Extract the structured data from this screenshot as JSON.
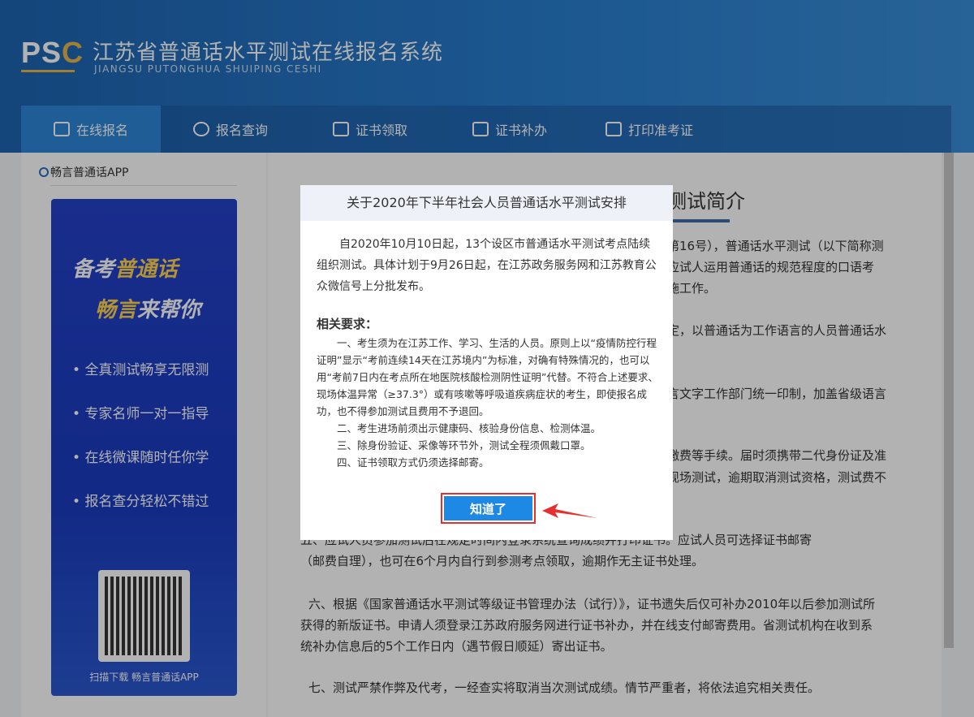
{
  "header": {
    "logo": "PSC",
    "title": "江苏省普通话水平测试在线报名系统",
    "subtitle": "JIANGSU PUTONGHUA SHUIPING CESHI"
  },
  "nav": [
    {
      "label": "在线报名",
      "icon": "edit-icon"
    },
    {
      "label": "报名查询",
      "icon": "search-icon"
    },
    {
      "label": "证书领取",
      "icon": "certificate-icon"
    },
    {
      "label": "证书补办",
      "icon": "certificate-icon"
    },
    {
      "label": "打印准考证",
      "icon": "printer-icon"
    }
  ],
  "sidebar": {
    "title": "畅言普通话APP",
    "banner_line1_a": "备考",
    "banner_line1_b": "普通话",
    "banner_line2_a": "畅言",
    "banner_line2_b": "来帮你",
    "features": [
      "全真测试畅享无限测",
      "专家名师一对一指导",
      "在线微课随时任你学",
      "报名查分轻松不错过"
    ],
    "qr_caption": "扫描下载 畅言普通话APP"
  },
  "article": {
    "title": "测试简介",
    "lines": [
      "第16号），普通话水平测试（以下简称测",
      "应试人运用普通话的规范程度的口语考",
      "施工作。",
      "定，以普通话为工作语言的人员普通话水",
      "言文字工作部门统一印制，加盖省级语言",
      "缴费等手续。届时须携带二代身份证及准",
      "现场测试，逾期取消测试资格，测试费不",
      "五、应试人员参加测试后在规定时间内登录系统查询成绩并打印证书。应试人员可选择证书邮寄",
      "（邮费自理），也可在6个月内自行到参测考点领取，逾期作无主证书处理。",
      "六、根据《国家普通话水平测试等级证书管理办法（试行）》，证书遗失后仅可补办2010年以后参加测试所",
      "获得的新版证书。申请人须登录江苏政府服务网进行证书补办，并在线支付邮寄费用。省测试机构在收到系",
      "统补办信息后的5个工作日内（遇节假日顺延）寄出证书。",
      "七、测试严禁作弊及代考，一经查实将取消当次测试成绩。情节严重者，将依法追究相关责任。"
    ]
  },
  "modal": {
    "title": "关于2020年下半年社会人员普通话水平测试安排",
    "intro": "自2020年10月10日起，13个设区市普通话水平测试考点陆续组织测试。具体计划于9月26日起，在江苏政务服务网和江苏教育公众微信号上分批发布。",
    "req_title": "相关要求：",
    "req1": "一、考生须为在江苏工作、学习、生活的人员。原则上以“疫情防控行程证明”显示“考前连续14天在江苏境内”为标准，对确有特殊情况的，也可以用“考前7日内在考点所在地医院核酸检测阴性证明”代替。不符合上述要求、现场体温异常（≥37.3°）或有咳嗽等呼吸道疾病症状的考生，即使报名成功，也不得参加测试且费用不予退回。",
    "req2": "二、考生进场前须出示健康码、核验身份信息、检测体温。",
    "req3": "三、除身份验证、采像等环节外，测试全程须佩戴口罩。",
    "req4": "四、证书领取方式仍须选择邮寄。",
    "button": "知道了"
  }
}
